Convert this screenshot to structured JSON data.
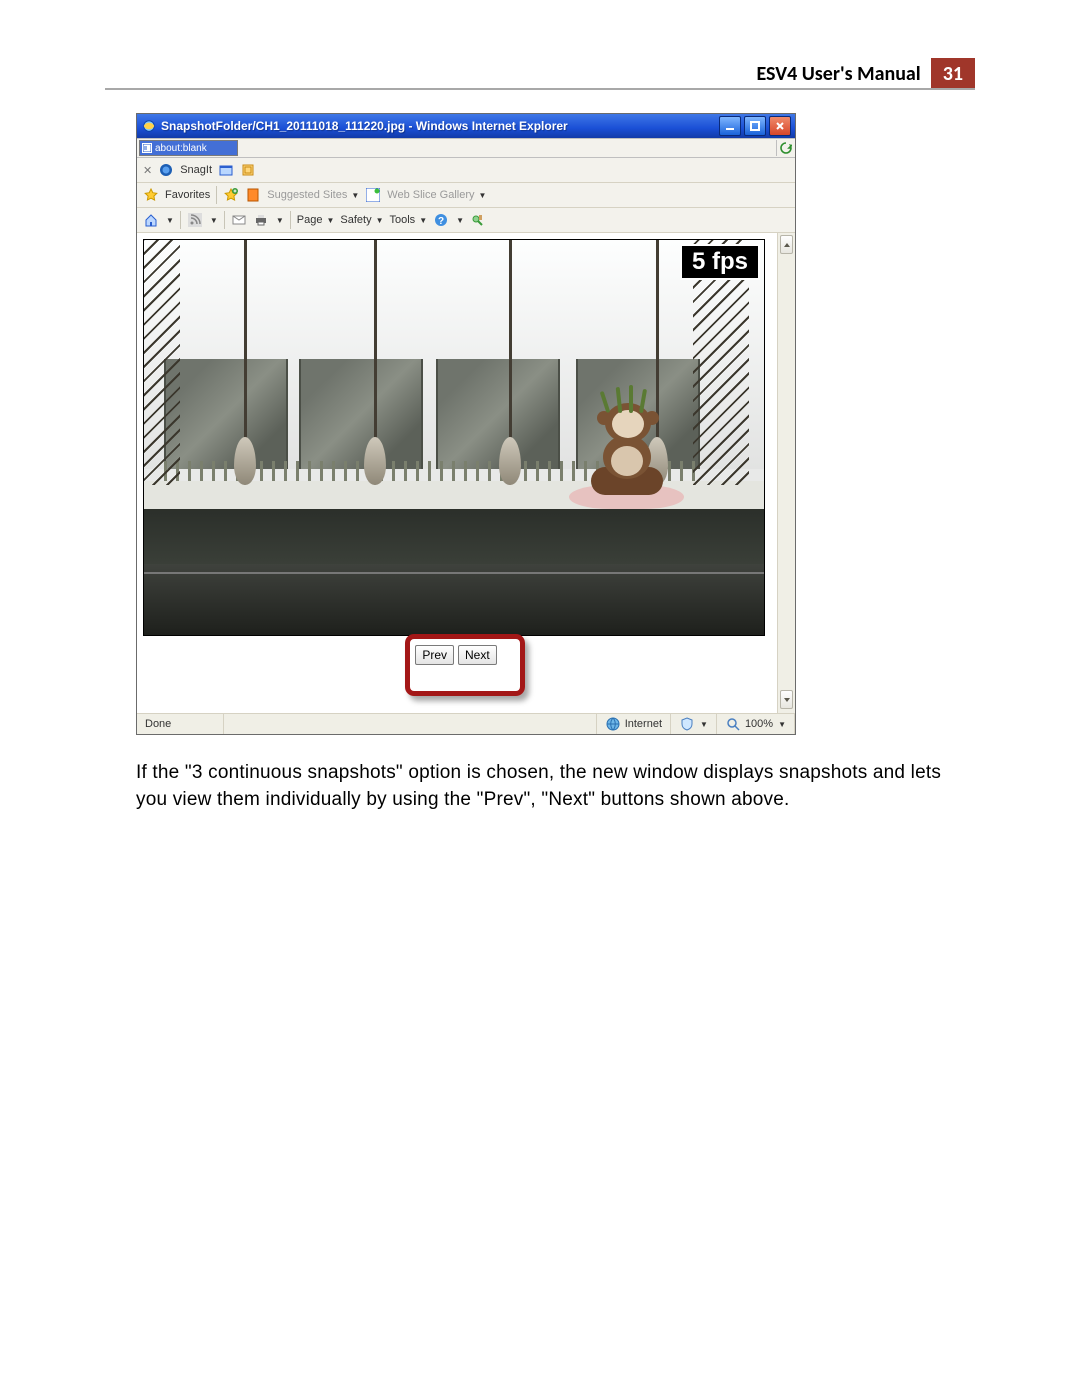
{
  "header": {
    "title": "ESV4 User's Manual",
    "page": "31"
  },
  "browser": {
    "title": "SnapshotFolder/CH1_20111018_111220.jpg - Windows Internet Explorer",
    "address": "about:blank",
    "snagit_label": "SnagIt",
    "favorites_label": "Favorites",
    "suggested_sites": "Suggested Sites",
    "web_slice": "Web Slice Gallery",
    "cmd": {
      "page": "Page",
      "safety": "Safety",
      "tools": "Tools"
    },
    "fps_overlay": "5 fps",
    "prev": "Prev",
    "next": "Next",
    "status_done": "Done",
    "status_zone": "Internet",
    "status_zoom": "100%"
  },
  "body_paragraph": "If the \"3 continuous snapshots\" option is chosen, the new window displays snapshots and lets you view them individually by using the \"Prev\", \"Next\" buttons shown above."
}
